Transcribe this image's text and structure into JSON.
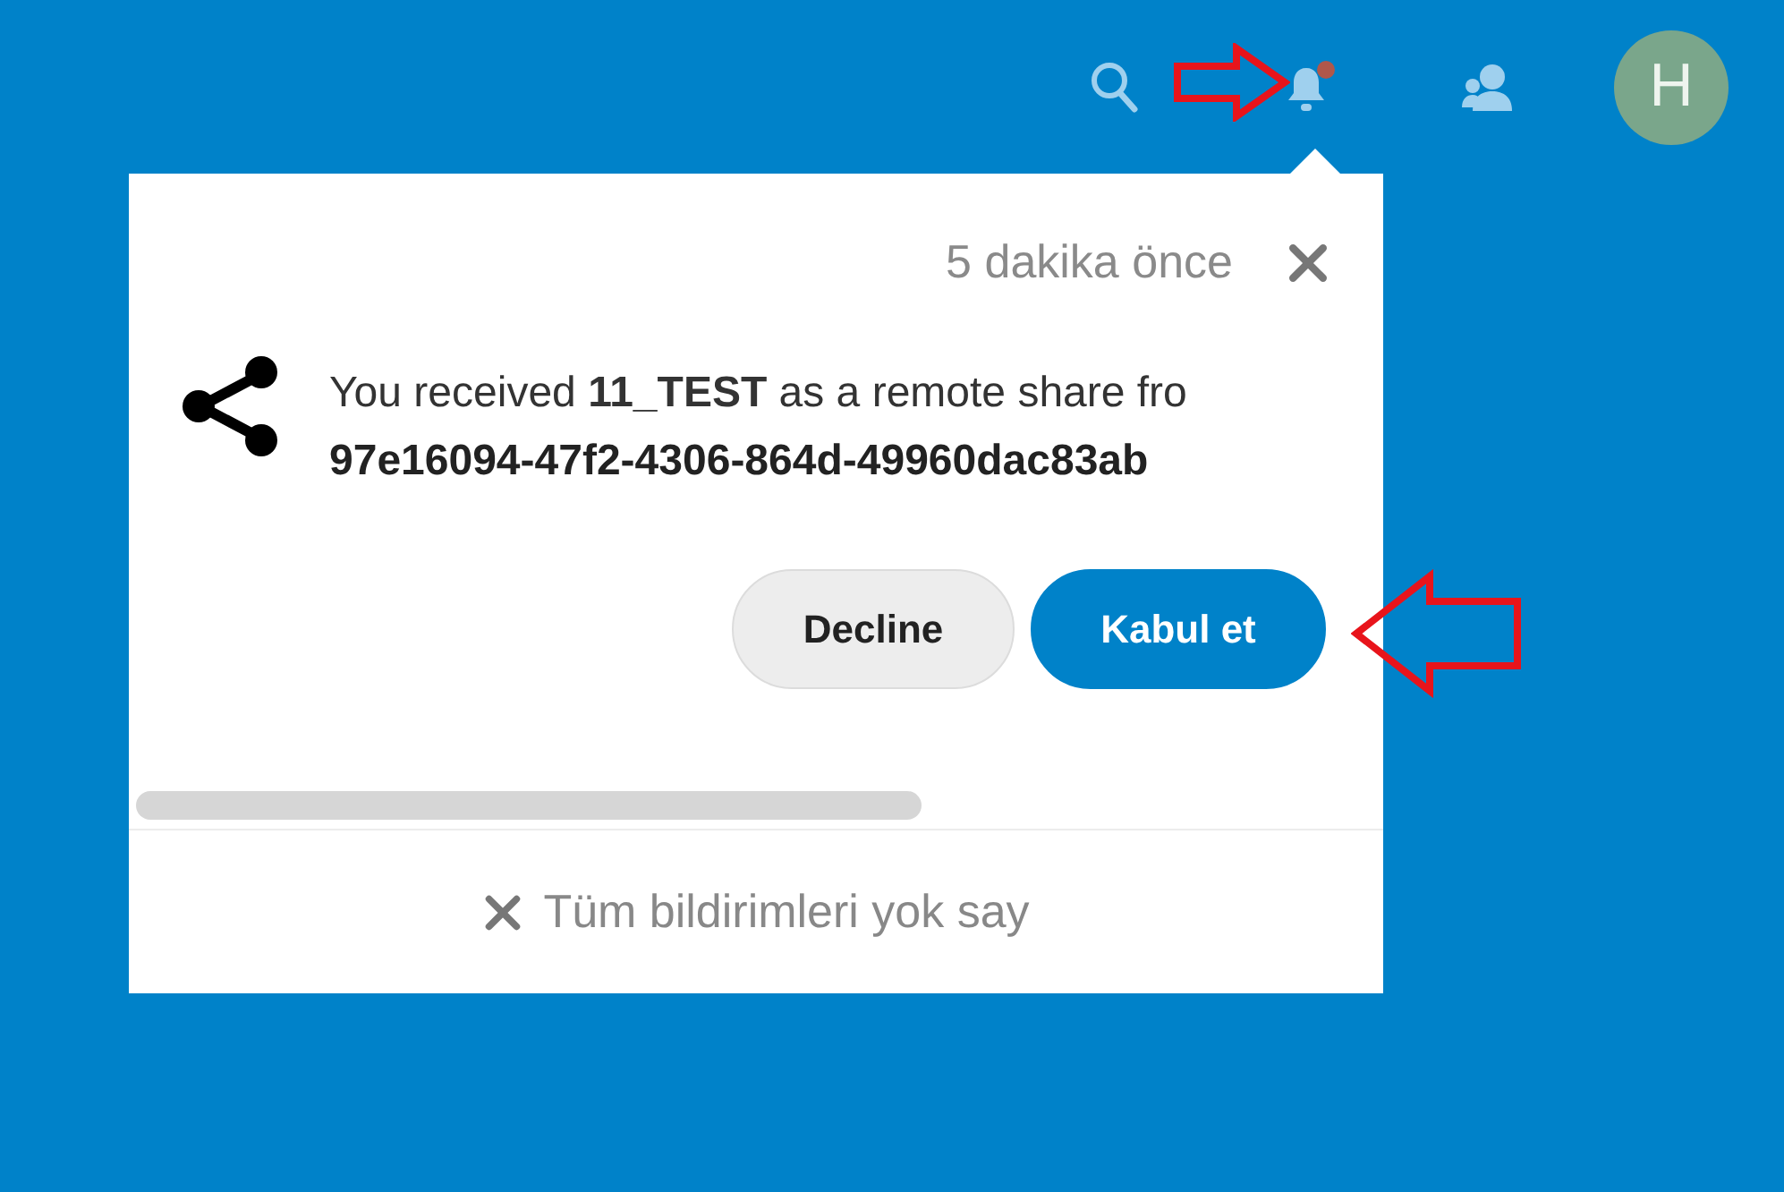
{
  "header": {
    "avatar_letter": "H",
    "notifications_unread": true
  },
  "notification": {
    "time": "5 dakika önce",
    "message": "You received **11_TEST** as a remote share fro",
    "sender": "97e16094-47f2-4306-864d-49960dac83ab",
    "actions": [
      {
        "label": "Decline",
        "kind": "secondary"
      },
      {
        "label": "Kabul et",
        "kind": "primary"
      }
    ]
  },
  "footer": {
    "dismiss_all": "Tüm bildirimleri yok say"
  }
}
